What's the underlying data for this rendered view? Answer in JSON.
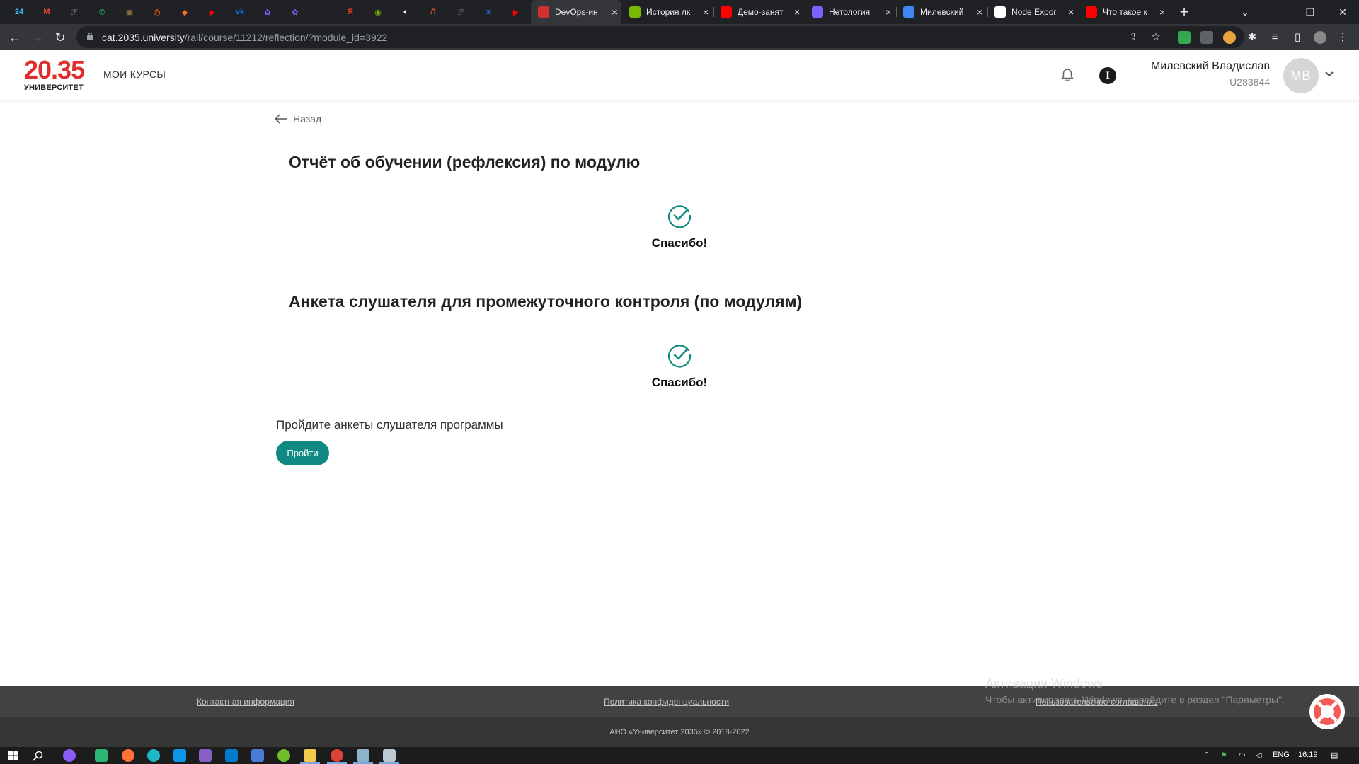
{
  "browser": {
    "pinned_tabs": [
      {
        "icon": "bitrix24-icon",
        "glyph": "24",
        "color": "#2fc6f6"
      },
      {
        "icon": "gmail-icon",
        "glyph": "M",
        "color": "#ea4335"
      },
      {
        "icon": "yandex-practicum-icon",
        "glyph": "ℱ",
        "color": "#5f6368"
      },
      {
        "icon": "whatsapp-icon",
        "glyph": "✆",
        "color": "#25d366"
      },
      {
        "icon": "image-app-icon",
        "glyph": "▣",
        "color": "#8a6d3b"
      },
      {
        "icon": "habr-icon",
        "glyph": "ℌ",
        "color": "#e8590c"
      },
      {
        "icon": "gitlab-icon",
        "glyph": "◆",
        "color": "#fc6d26"
      },
      {
        "icon": "youtube-icon",
        "glyph": "▶",
        "color": "#ff0000"
      },
      {
        "icon": "vk-icon",
        "glyph": "vk",
        "color": "#0077ff"
      },
      {
        "icon": "netology-icon",
        "glyph": "✿",
        "color": "#7b61ff"
      },
      {
        "icon": "netology-icon",
        "glyph": "✿",
        "color": "#7b61ff"
      },
      {
        "icon": "github-icon",
        "glyph": "●",
        "color": "#24292e"
      },
      {
        "icon": "yandex-icon",
        "glyph": "Я",
        "color": "#fc3f1d"
      },
      {
        "icon": "nvidia-icon",
        "glyph": "◉",
        "color": "#76b900"
      },
      {
        "icon": "globe-icon",
        "glyph": "◐",
        "color": "#ffffff"
      },
      {
        "icon": "lms-icon",
        "glyph": "Л",
        "color": "#e44b3b"
      },
      {
        "icon": "yandex-practicum-icon",
        "glyph": "ℱ",
        "color": "#5f6368"
      },
      {
        "icon": "mail-icon",
        "glyph": "✉",
        "color": "#1a73e8"
      },
      {
        "icon": "youtube-icon",
        "glyph": "▶",
        "color": "#ff0000"
      }
    ],
    "tabs": [
      {
        "title": "DevOps-ин",
        "icon": "university-2035-icon",
        "color": "#d32f2f",
        "active": true
      },
      {
        "title": "История лк",
        "icon": "nvidia-icon",
        "color": "#76b900",
        "active": false
      },
      {
        "title": "Демо-занят",
        "icon": "youtube-icon",
        "color": "#ff0000",
        "active": false
      },
      {
        "title": "Нетология",
        "icon": "netology-icon",
        "color": "#7b61ff",
        "active": false
      },
      {
        "title": "Милевский",
        "icon": "google-docs-icon",
        "color": "#4285f4",
        "active": false
      },
      {
        "title": "Node Expor",
        "icon": "google-icon",
        "color": "#ffffff",
        "active": false
      },
      {
        "title": "Что такое к",
        "icon": "youtube-icon",
        "color": "#ff0000",
        "active": false
      }
    ],
    "url_host": "cat.2035.university",
    "url_path": "/rall/course/11212/reflection/?module_id=3922"
  },
  "header": {
    "logo_number": "20.35",
    "logo_text": "УНИВЕРСИТЕТ",
    "nav_my_courses": "МОИ КУРСЫ",
    "info_glyph": "I",
    "user_name": "Милевский Владислав",
    "user_id": "U283844",
    "avatar_initials": "МВ"
  },
  "main": {
    "back_label": "Назад",
    "sections": [
      {
        "title": "Отчёт об обучении (рефлексия) по модулю",
        "status": "Спасибо!"
      },
      {
        "title": "Анкета слушателя для промежуточного контроля (по модулям)",
        "status": "Спасибо!"
      }
    ],
    "prompt": "Пройдите анкеты слушателя программы",
    "go_button": "Пройти",
    "accent_color": "#0f8a82"
  },
  "footer": {
    "contacts_link": "Контактная информация",
    "privacy_link": "Политика конфиденциальности",
    "agreement_link": "Пользовательское соглашение",
    "copyright": "АНО «Университет 2035» © 2018-2022"
  },
  "watermark": {
    "line1": "Активация Windows",
    "line2": "Чтобы активировать Windows, перейдите в раздел \"Параметры\"."
  },
  "taskbar": {
    "language": "ENG",
    "time": "16:19"
  }
}
